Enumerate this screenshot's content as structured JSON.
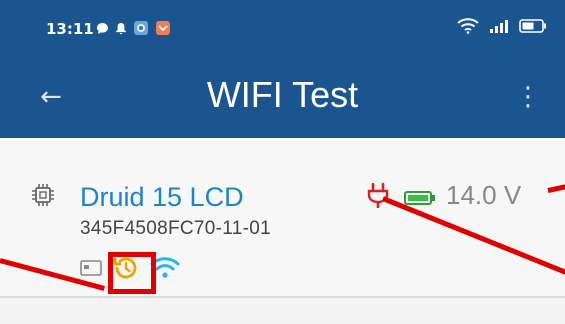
{
  "status_bar": {
    "time": "13:11",
    "left_icons": [
      "chat-bubble-icon",
      "bell-icon",
      "app-icon",
      "shield-icon"
    ],
    "right_icons": [
      "wifi-icon",
      "signal-icon",
      "battery-icon"
    ]
  },
  "app_bar": {
    "title": "WIFI Test",
    "back_icon": "back-arrow-icon",
    "menu_icon": "overflow-menu-icon",
    "color": "#1a5590"
  },
  "device": {
    "name": "Druid 15 LCD",
    "id": "345F4508FC70-11-01",
    "voltage": "14.0 V",
    "name_color": "#1c84c9",
    "icons": [
      "chip-icon",
      "plug-icon",
      "battery-icon",
      "card-icon",
      "history-icon",
      "wifi-icon"
    ]
  },
  "annotations": {
    "highlight_color": "#e00000"
  }
}
